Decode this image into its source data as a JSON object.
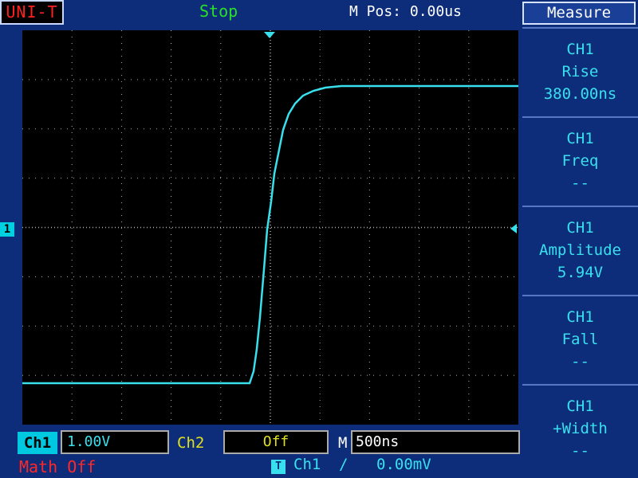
{
  "header": {
    "brand": "UNI-T",
    "run_status": "Stop",
    "mpos": "M Pos: 0.00us"
  },
  "menu": {
    "title": "Measure",
    "items": [
      {
        "channel": "CH1",
        "name": "Rise",
        "value": "380.00ns"
      },
      {
        "channel": "CH1",
        "name": "Freq",
        "value": "--"
      },
      {
        "channel": "CH1",
        "name": "Amplitude",
        "value": "5.94V"
      },
      {
        "channel": "CH1",
        "name": "Fall",
        "value": "--"
      },
      {
        "channel": "CH1",
        "name": "+Width",
        "value": "--"
      }
    ]
  },
  "channels": {
    "ch1_marker": "1",
    "ch1_label": "Ch1",
    "ch1_scale": "1.00V",
    "ch2_label": "Ch2",
    "ch2_scale": "Off"
  },
  "timebase": {
    "label": "M",
    "value": "500ns"
  },
  "math": "Math Off",
  "trigger": {
    "icon": "T",
    "source": "Ch1",
    "slope": "/",
    "level": "0.00mV"
  },
  "colors": {
    "background": "#0d2d7a",
    "trace": "#38e0ee",
    "ch2": "#e0e020",
    "status": "#28e028",
    "brand": "#ff2020"
  }
}
